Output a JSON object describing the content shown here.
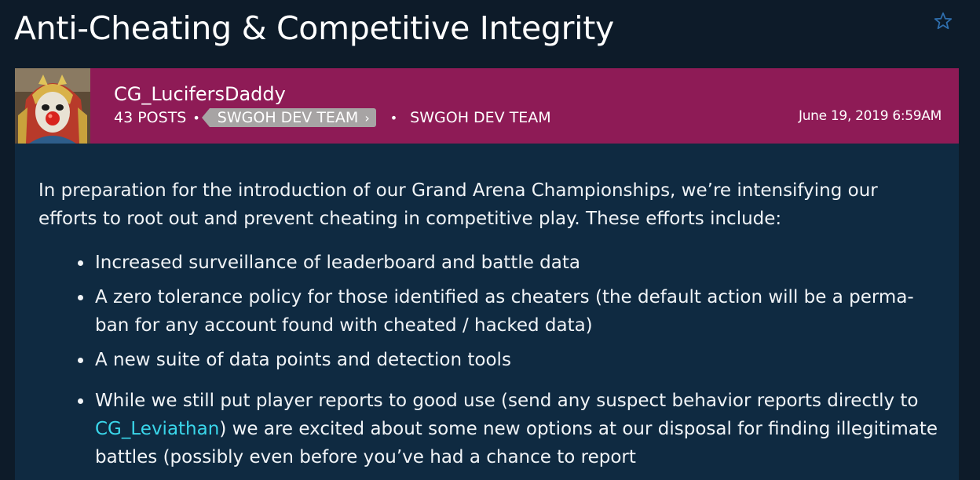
{
  "thread": {
    "title": "Anti-Cheating & Competitive Integrity",
    "bookmark_icon": "star-icon"
  },
  "post": {
    "author": "CG_LucifersDaddy",
    "posts_count": "43 POSTS",
    "role_badge": "SWGOH DEV TEAM",
    "role_badge_chevron": "›",
    "role": "SWGOH DEV TEAM",
    "date": "June 19, 2019 6:59AM",
    "intro": "In preparation for the introduction of our Grand Arena Championships, we’re intensifying our efforts to root out and prevent cheating in competitive play. These efforts include:",
    "bullets": [
      "Increased surveillance of leaderboard and battle data",
      "A zero tolerance policy for those identified as cheaters (the default action will be a perma-ban for any account found with cheated / hacked data)",
      "A new suite of data points and detection tools"
    ],
    "sub_bullet": {
      "before": "While we still put player reports to good use (send any suspect behavior reports directly to ",
      "link": "CG_Leviathan",
      "after": ") we are excited about some new options at our disposal for finding illegitimate battles (possibly even before you’ve had a chance to report"
    }
  },
  "colors": {
    "page_bg": "#0d1b29",
    "header_bg": "#8e1b56",
    "body_bg": "#0f2a41",
    "badge_bg": "#a7a4a4",
    "link": "#3ad6ea"
  }
}
